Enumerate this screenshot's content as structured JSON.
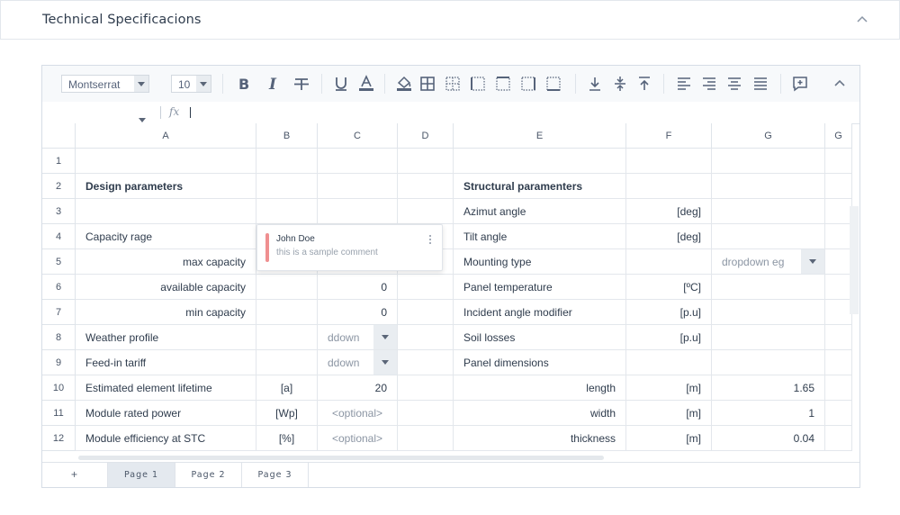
{
  "panel": {
    "title": "Technical Specificacions"
  },
  "toolbar": {
    "font": "Montserrat",
    "size": "10"
  },
  "columns": [
    "A",
    "B",
    "C",
    "D",
    "E",
    "F",
    "G",
    "G"
  ],
  "rows": [
    "1",
    "2",
    "3",
    "4",
    "5",
    "6",
    "7",
    "8",
    "9",
    "10",
    "11",
    "12"
  ],
  "cells": {
    "A2": "Design parameters",
    "A4": "Capacity rage",
    "A5": "max capacity",
    "A6": "available capacity",
    "A7": "min capacity",
    "A8": "Weather profile",
    "A9": "Feed-in tariff",
    "A10": "Estimated element lifetime",
    "A11": "Module rated power",
    "A12": "Module efficiency at STC",
    "B10": "[a]",
    "B11": "[Wp]",
    "B12": "[%]",
    "C6": "0",
    "C7": "0",
    "C8": "ddown",
    "C9": "ddown",
    "C10": "20",
    "C11": "<optional>",
    "C12": "<optional>",
    "E2": "Structural paramenters",
    "E3": "Azimut angle",
    "E4": "Tilt angle",
    "E5": "Mounting type",
    "E6": "Panel temperature",
    "E7": "Incident angle modifier",
    "E8": "Soil losses",
    "E9": "Panel dimensions",
    "E10": "length",
    "E11": "width",
    "E12": "thickness",
    "F3": "[deg]",
    "F4": "[deg]",
    "F6": "[ºC]",
    "F7": "[p.u]",
    "F8": "[p.u]",
    "F10": "[m]",
    "F11": "[m]",
    "F12": "[m]",
    "G5": "dropdown eg",
    "G10": "1.65",
    "G11": "1",
    "G12": "0.04"
  },
  "comment": {
    "author": "John Doe",
    "text": "this is a sample comment"
  },
  "tabs": {
    "add": "+",
    "items": [
      "Page 1",
      "Page 2",
      "Page 3"
    ]
  }
}
